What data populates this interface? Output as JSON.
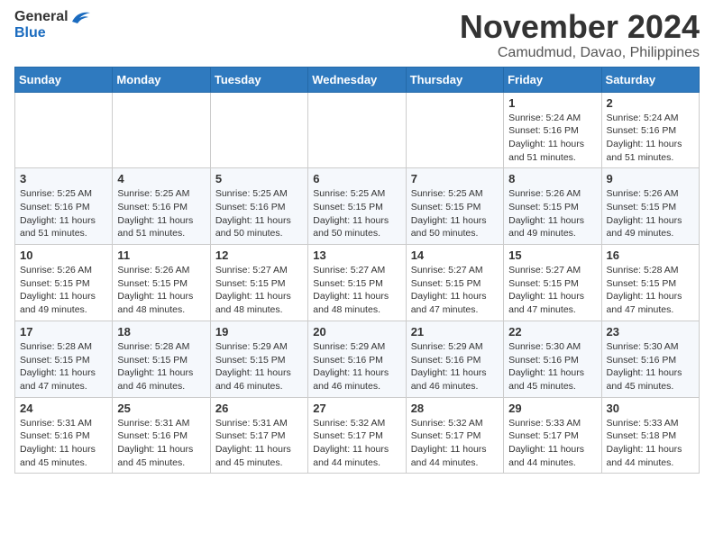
{
  "header": {
    "logo_general": "General",
    "logo_blue": "Blue",
    "month_title": "November 2024",
    "location": "Camudmud, Davao, Philippines"
  },
  "weekdays": [
    "Sunday",
    "Monday",
    "Tuesday",
    "Wednesday",
    "Thursday",
    "Friday",
    "Saturday"
  ],
  "weeks": [
    [
      {
        "day": "",
        "sunrise": "",
        "sunset": "",
        "daylight": ""
      },
      {
        "day": "",
        "sunrise": "",
        "sunset": "",
        "daylight": ""
      },
      {
        "day": "",
        "sunrise": "",
        "sunset": "",
        "daylight": ""
      },
      {
        "day": "",
        "sunrise": "",
        "sunset": "",
        "daylight": ""
      },
      {
        "day": "",
        "sunrise": "",
        "sunset": "",
        "daylight": ""
      },
      {
        "day": "1",
        "sunrise": "Sunrise: 5:24 AM",
        "sunset": "Sunset: 5:16 PM",
        "daylight": "Daylight: 11 hours and 51 minutes."
      },
      {
        "day": "2",
        "sunrise": "Sunrise: 5:24 AM",
        "sunset": "Sunset: 5:16 PM",
        "daylight": "Daylight: 11 hours and 51 minutes."
      }
    ],
    [
      {
        "day": "3",
        "sunrise": "Sunrise: 5:25 AM",
        "sunset": "Sunset: 5:16 PM",
        "daylight": "Daylight: 11 hours and 51 minutes."
      },
      {
        "day": "4",
        "sunrise": "Sunrise: 5:25 AM",
        "sunset": "Sunset: 5:16 PM",
        "daylight": "Daylight: 11 hours and 51 minutes."
      },
      {
        "day": "5",
        "sunrise": "Sunrise: 5:25 AM",
        "sunset": "Sunset: 5:16 PM",
        "daylight": "Daylight: 11 hours and 50 minutes."
      },
      {
        "day": "6",
        "sunrise": "Sunrise: 5:25 AM",
        "sunset": "Sunset: 5:15 PM",
        "daylight": "Daylight: 11 hours and 50 minutes."
      },
      {
        "day": "7",
        "sunrise": "Sunrise: 5:25 AM",
        "sunset": "Sunset: 5:15 PM",
        "daylight": "Daylight: 11 hours and 50 minutes."
      },
      {
        "day": "8",
        "sunrise": "Sunrise: 5:26 AM",
        "sunset": "Sunset: 5:15 PM",
        "daylight": "Daylight: 11 hours and 49 minutes."
      },
      {
        "day": "9",
        "sunrise": "Sunrise: 5:26 AM",
        "sunset": "Sunset: 5:15 PM",
        "daylight": "Daylight: 11 hours and 49 minutes."
      }
    ],
    [
      {
        "day": "10",
        "sunrise": "Sunrise: 5:26 AM",
        "sunset": "Sunset: 5:15 PM",
        "daylight": "Daylight: 11 hours and 49 minutes."
      },
      {
        "day": "11",
        "sunrise": "Sunrise: 5:26 AM",
        "sunset": "Sunset: 5:15 PM",
        "daylight": "Daylight: 11 hours and 48 minutes."
      },
      {
        "day": "12",
        "sunrise": "Sunrise: 5:27 AM",
        "sunset": "Sunset: 5:15 PM",
        "daylight": "Daylight: 11 hours and 48 minutes."
      },
      {
        "day": "13",
        "sunrise": "Sunrise: 5:27 AM",
        "sunset": "Sunset: 5:15 PM",
        "daylight": "Daylight: 11 hours and 48 minutes."
      },
      {
        "day": "14",
        "sunrise": "Sunrise: 5:27 AM",
        "sunset": "Sunset: 5:15 PM",
        "daylight": "Daylight: 11 hours and 47 minutes."
      },
      {
        "day": "15",
        "sunrise": "Sunrise: 5:27 AM",
        "sunset": "Sunset: 5:15 PM",
        "daylight": "Daylight: 11 hours and 47 minutes."
      },
      {
        "day": "16",
        "sunrise": "Sunrise: 5:28 AM",
        "sunset": "Sunset: 5:15 PM",
        "daylight": "Daylight: 11 hours and 47 minutes."
      }
    ],
    [
      {
        "day": "17",
        "sunrise": "Sunrise: 5:28 AM",
        "sunset": "Sunset: 5:15 PM",
        "daylight": "Daylight: 11 hours and 47 minutes."
      },
      {
        "day": "18",
        "sunrise": "Sunrise: 5:28 AM",
        "sunset": "Sunset: 5:15 PM",
        "daylight": "Daylight: 11 hours and 46 minutes."
      },
      {
        "day": "19",
        "sunrise": "Sunrise: 5:29 AM",
        "sunset": "Sunset: 5:15 PM",
        "daylight": "Daylight: 11 hours and 46 minutes."
      },
      {
        "day": "20",
        "sunrise": "Sunrise: 5:29 AM",
        "sunset": "Sunset: 5:16 PM",
        "daylight": "Daylight: 11 hours and 46 minutes."
      },
      {
        "day": "21",
        "sunrise": "Sunrise: 5:29 AM",
        "sunset": "Sunset: 5:16 PM",
        "daylight": "Daylight: 11 hours and 46 minutes."
      },
      {
        "day": "22",
        "sunrise": "Sunrise: 5:30 AM",
        "sunset": "Sunset: 5:16 PM",
        "daylight": "Daylight: 11 hours and 45 minutes."
      },
      {
        "day": "23",
        "sunrise": "Sunrise: 5:30 AM",
        "sunset": "Sunset: 5:16 PM",
        "daylight": "Daylight: 11 hours and 45 minutes."
      }
    ],
    [
      {
        "day": "24",
        "sunrise": "Sunrise: 5:31 AM",
        "sunset": "Sunset: 5:16 PM",
        "daylight": "Daylight: 11 hours and 45 minutes."
      },
      {
        "day": "25",
        "sunrise": "Sunrise: 5:31 AM",
        "sunset": "Sunset: 5:16 PM",
        "daylight": "Daylight: 11 hours and 45 minutes."
      },
      {
        "day": "26",
        "sunrise": "Sunrise: 5:31 AM",
        "sunset": "Sunset: 5:17 PM",
        "daylight": "Daylight: 11 hours and 45 minutes."
      },
      {
        "day": "27",
        "sunrise": "Sunrise: 5:32 AM",
        "sunset": "Sunset: 5:17 PM",
        "daylight": "Daylight: 11 hours and 44 minutes."
      },
      {
        "day": "28",
        "sunrise": "Sunrise: 5:32 AM",
        "sunset": "Sunset: 5:17 PM",
        "daylight": "Daylight: 11 hours and 44 minutes."
      },
      {
        "day": "29",
        "sunrise": "Sunrise: 5:33 AM",
        "sunset": "Sunset: 5:17 PM",
        "daylight": "Daylight: 11 hours and 44 minutes."
      },
      {
        "day": "30",
        "sunrise": "Sunrise: 5:33 AM",
        "sunset": "Sunset: 5:18 PM",
        "daylight": "Daylight: 11 hours and 44 minutes."
      }
    ]
  ]
}
